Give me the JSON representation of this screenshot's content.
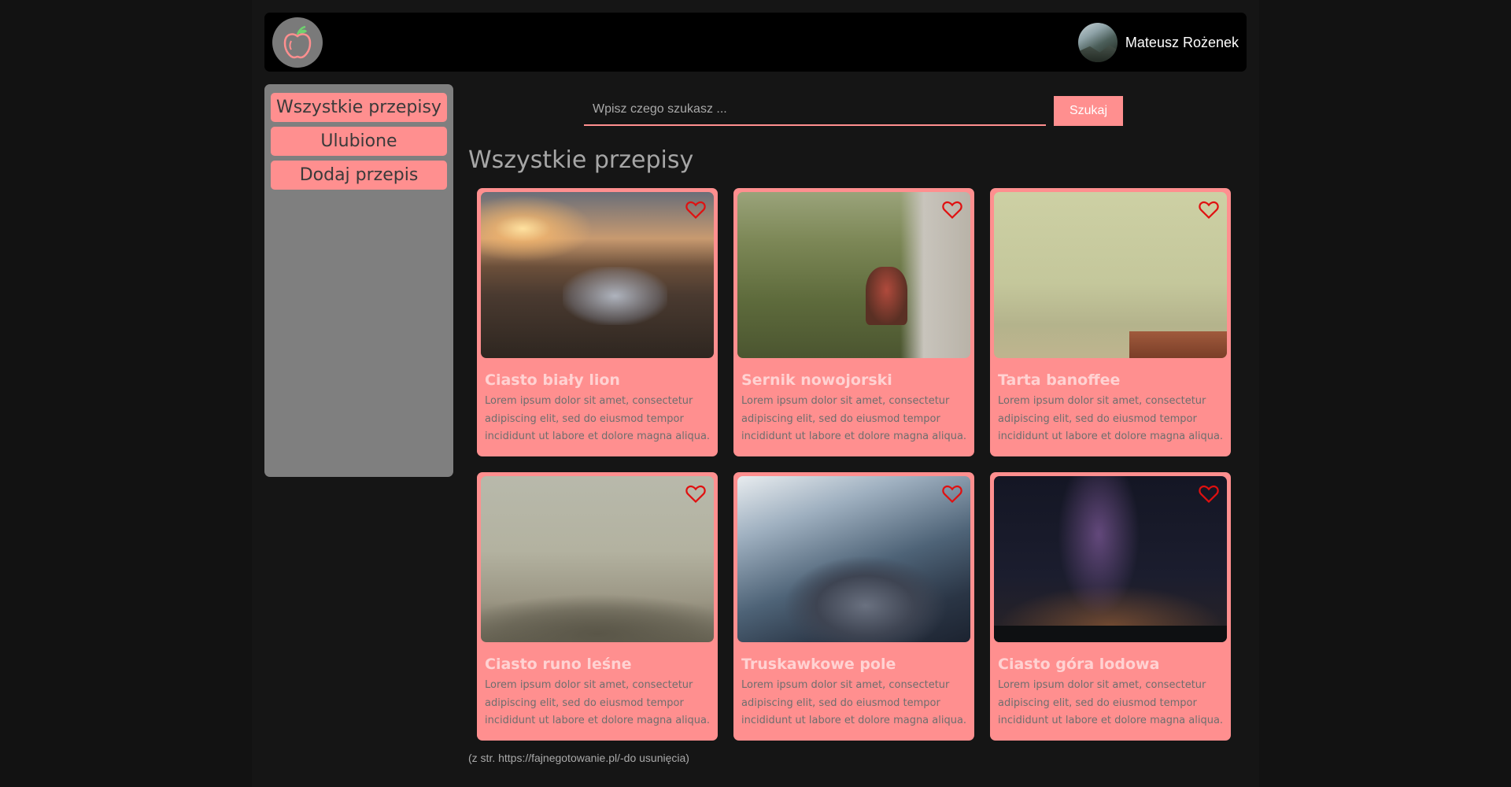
{
  "header": {
    "logo_icon": "apple-icon",
    "user_name": "Mateusz Rożenek"
  },
  "sidebar": {
    "items": [
      {
        "label": "Wszystkie przepisy"
      },
      {
        "label": "Ulubione"
      },
      {
        "label": "Dodaj przepis"
      }
    ]
  },
  "search": {
    "placeholder": "Wpisz czego szukasz ...",
    "button_label": "Szukaj"
  },
  "main": {
    "title": "Wszystkie przepisy",
    "footnote": "(z str. https://fajnegotowanie.pl/-do usunięcia)"
  },
  "recipes": [
    {
      "title": "Ciasto biały lion",
      "description": "Lorem ipsum dolor sit amet, consectetur adipiscing elit, sed do eiusmod tempor incididunt ut labore et dolore magna aliqua.",
      "favorite_icon": "heart-icon"
    },
    {
      "title": "Sernik nowojorski",
      "description": "Lorem ipsum dolor sit amet, consectetur adipiscing elit, sed do eiusmod tempor incididunt ut labore et dolore magna aliqua.",
      "favorite_icon": "heart-icon"
    },
    {
      "title": "Tarta banoffee",
      "description": "Lorem ipsum dolor sit amet, consectetur adipiscing elit, sed do eiusmod tempor incididunt ut labore et dolore magna aliqua.",
      "favorite_icon": "heart-icon"
    },
    {
      "title": "Ciasto runo leśne",
      "description": "Lorem ipsum dolor sit amet, consectetur adipiscing elit, sed do eiusmod tempor incididunt ut labore et dolore magna aliqua.",
      "favorite_icon": "heart-icon"
    },
    {
      "title": "Truskawkowe pole",
      "description": "Lorem ipsum dolor sit amet, consectetur adipiscing elit, sed do eiusmod tempor incididunt ut labore et dolore magna aliqua.",
      "favorite_icon": "heart-icon"
    },
    {
      "title": "Ciasto góra lodowa",
      "description": "Lorem ipsum dolor sit amet, consectetur adipiscing elit, sed do eiusmod tempor incididunt ut labore et dolore magna aliqua.",
      "favorite_icon": "heart-icon"
    }
  ],
  "colors": {
    "accent": "#ff8f8f",
    "heart": "#e01010",
    "sidebar_bg": "#7f7f7f",
    "header_bg": "#000000"
  }
}
